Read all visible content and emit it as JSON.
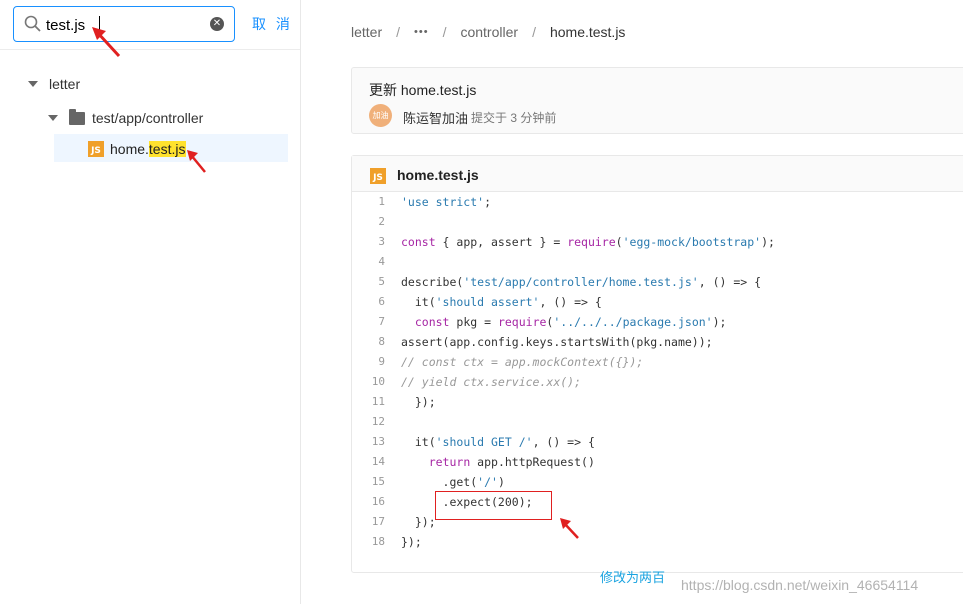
{
  "search": {
    "value": "test.js",
    "cancel_label": "取 消"
  },
  "tree": {
    "root_label": "letter",
    "folder_label": "test/app/controller",
    "file": {
      "icon_text": "JS",
      "name_prefix": "home.",
      "name_match": "test.js"
    }
  },
  "breadcrumb": {
    "root": "letter",
    "sep": "/",
    "ellipsis": "•••",
    "folder": "controller",
    "current": "home.test.js"
  },
  "commit": {
    "title": "更新 home.test.js",
    "avatar_text": "加油",
    "author": "陈运智加油",
    "time": "提交于 3 分钟前"
  },
  "file_view": {
    "icon_text": "JS",
    "title": "home.test.js",
    "lines": [
      {
        "n": "1",
        "html": "<span class=\"str\">'use strict'</span>;"
      },
      {
        "n": "2",
        "html": ""
      },
      {
        "n": "3",
        "html": "<span class=\"kw\">const</span> { app, assert } = <span class=\"kw\">require</span>(<span class=\"str\">'egg-mock/bootstrap'</span>);"
      },
      {
        "n": "4",
        "html": ""
      },
      {
        "n": "5",
        "html": "describe(<span class=\"str\">'test/app/controller/home.test.js'</span>, () =&gt; {"
      },
      {
        "n": "6",
        "html": "  it(<span class=\"str\">'should assert'</span>, () =&gt; {"
      },
      {
        "n": "7",
        "html": "  <span class=\"kw\">const</span> pkg = <span class=\"kw\">require</span>(<span class=\"str\">'../../../package.json'</span>);"
      },
      {
        "n": "8",
        "html": "assert(app.config.keys.startsWith(pkg.name));"
      },
      {
        "n": "9",
        "html": "<span class=\"cm\">// const ctx = app.mockContext({});</span>"
      },
      {
        "n": "10",
        "html": "<span class=\"cm\">// yield ctx.service.xx();</span>"
      },
      {
        "n": "11",
        "html": "  });"
      },
      {
        "n": "12",
        "html": ""
      },
      {
        "n": "13",
        "html": "  it(<span class=\"str\">'should GET /'</span>, () =&gt; {"
      },
      {
        "n": "14",
        "html": "    <span class=\"kw\">return</span> app.httpRequest()"
      },
      {
        "n": "15",
        "html": "      .get(<span class=\"str\">'/'</span>)"
      },
      {
        "n": "16",
        "html": "      .expect(200);"
      },
      {
        "n": "17",
        "html": "  });"
      },
      {
        "n": "18",
        "html": "});"
      }
    ]
  },
  "annotation": {
    "note": "修改为两百"
  },
  "watermark": "https://blog.csdn.net/weixin_46654114",
  "colors": {
    "accent": "#1890ff",
    "highlight": "#ffe22e",
    "annotation_red": "#e02020",
    "js_icon": "#f0a02a"
  }
}
